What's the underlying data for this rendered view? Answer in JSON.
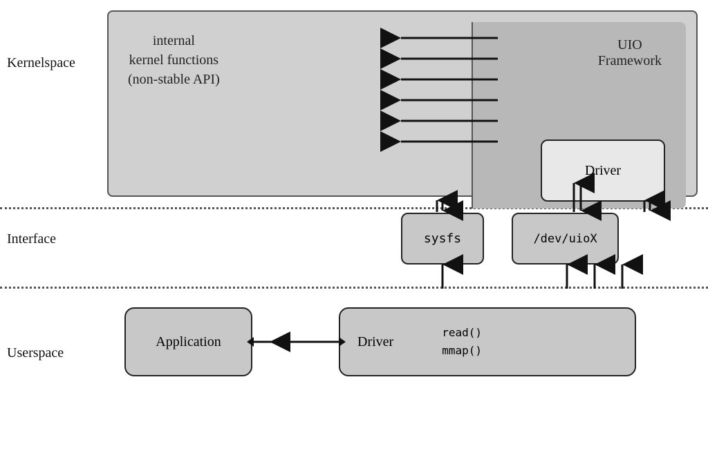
{
  "labels": {
    "kernelspace": "Kernelspace",
    "interface": "Interface",
    "userspace": "Userspace"
  },
  "boxes": {
    "kernel_functions": {
      "line1": "internal",
      "line2": "kernel functions",
      "line3": "(non-stable API)"
    },
    "uio_framework": {
      "line1": "UIO",
      "line2": "Framework"
    },
    "driver_kernel": "Driver",
    "sysfs": "sysfs",
    "devuio": "/dev/uioX",
    "application": "Application",
    "driver_user": "Driver",
    "read_mmap": {
      "line1": "read()",
      "line2": "mmap()"
    }
  },
  "colors": {
    "background": "#ffffff",
    "box_outer": "#d0d0d0",
    "box_inner": "#c8c8c8",
    "box_white": "#e8e8e8",
    "uio_bg": "#b8b8b8",
    "border": "#222222",
    "text": "#222222"
  }
}
